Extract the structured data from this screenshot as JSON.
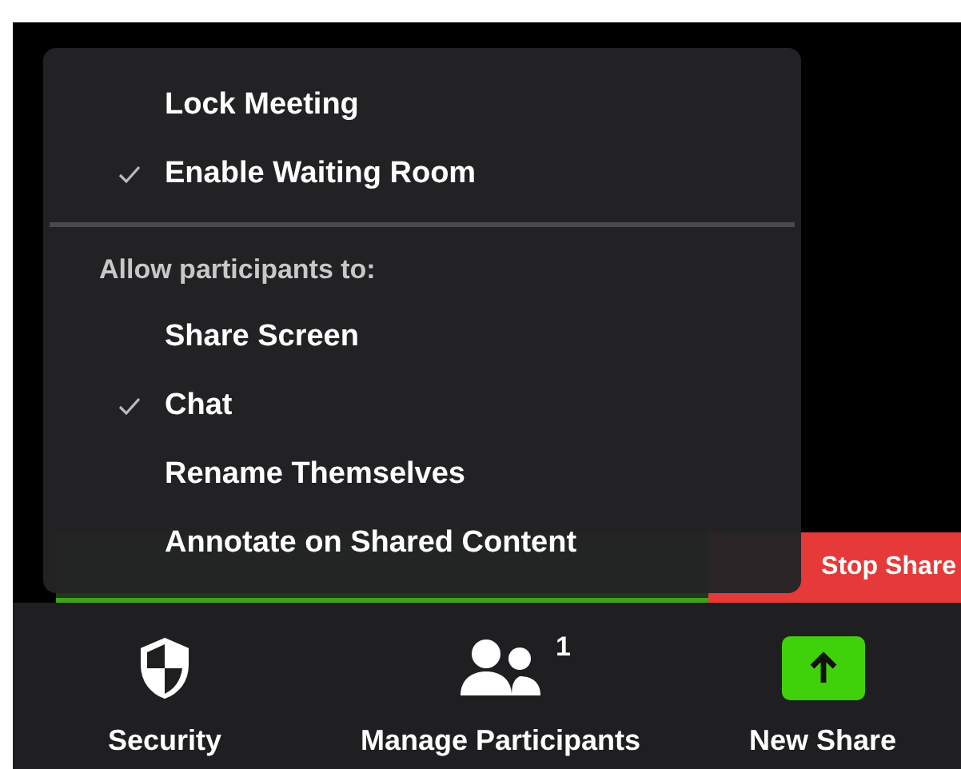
{
  "menu": {
    "items": [
      {
        "kind": "option",
        "label": "Lock Meeting",
        "checked": false
      },
      {
        "kind": "option",
        "label": "Enable Waiting Room",
        "checked": true
      },
      {
        "kind": "divider"
      },
      {
        "kind": "header",
        "label": "Allow participants to:"
      },
      {
        "kind": "option",
        "label": "Share Screen",
        "checked": false
      },
      {
        "kind": "option",
        "label": "Chat",
        "checked": true
      },
      {
        "kind": "option",
        "label": "Rename Themselves",
        "checked": false
      },
      {
        "kind": "option",
        "label": "Annotate on Shared Content",
        "checked": false
      }
    ]
  },
  "share_bar": {
    "stop_button": "Stop Share"
  },
  "toolbar": {
    "buttons": [
      {
        "kind": "security",
        "label": "Security"
      },
      {
        "kind": "participants",
        "label": "Manage Participants",
        "count": "1"
      },
      {
        "kind": "share",
        "label": "New Share"
      }
    ]
  }
}
